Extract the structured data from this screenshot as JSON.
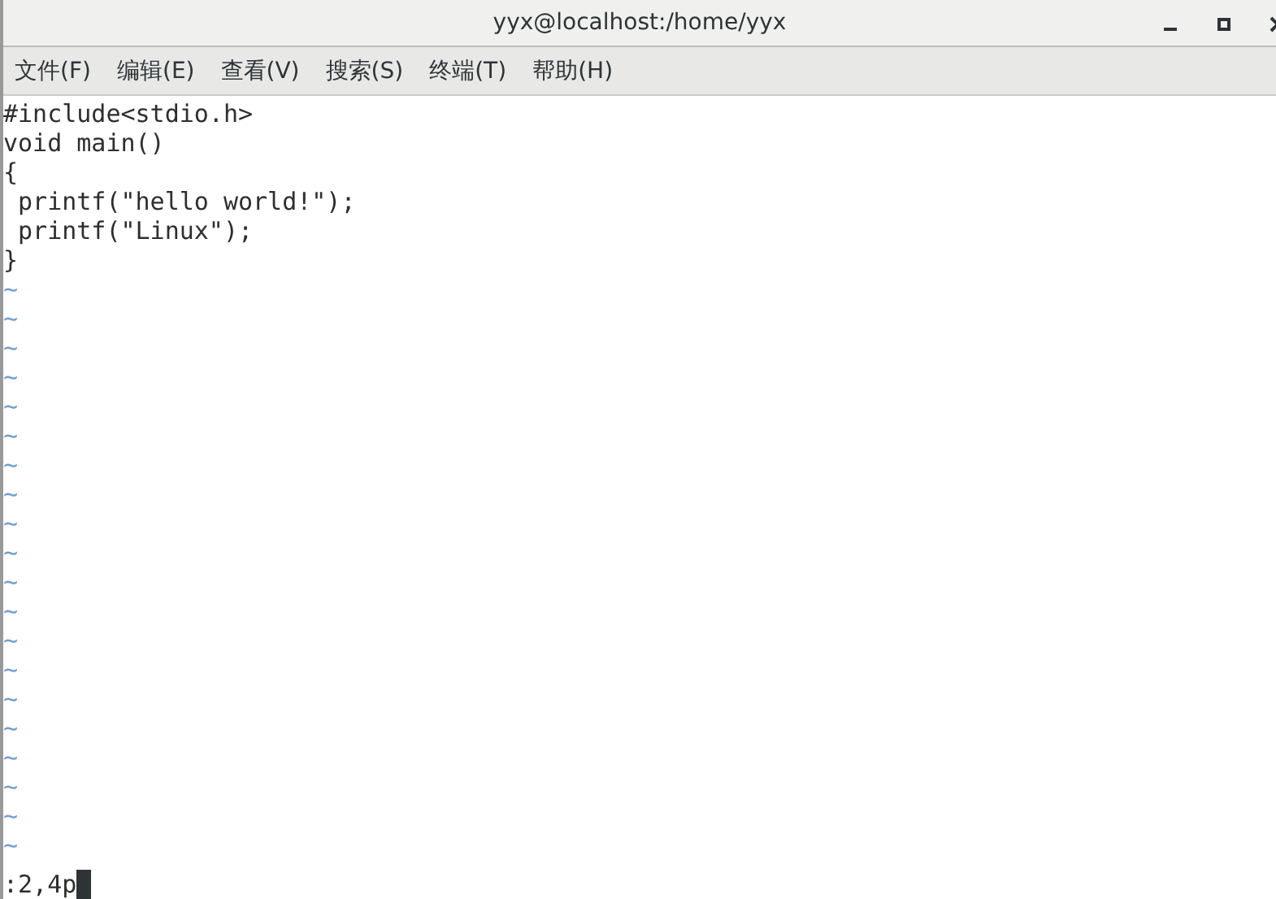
{
  "window": {
    "title": "yyx@localhost:/home/yyx"
  },
  "menu": [
    "文件(F)",
    "编辑(E)",
    "查看(V)",
    "搜索(S)",
    "终端(T)",
    "帮助(H)"
  ],
  "editor": {
    "lines": [
      "#include<stdio.h>",
      "void main()",
      "{",
      " printf(\"hello world!\");",
      " printf(\"Linux\");",
      "}"
    ],
    "empty_lines": [
      "~",
      "~",
      "~",
      "~",
      "~",
      "~",
      "~",
      "~",
      "~",
      "~",
      "~",
      "~",
      "~",
      "~",
      "~",
      "~",
      "~",
      "~",
      "~",
      "~"
    ],
    "command_line": ":2,4p"
  }
}
